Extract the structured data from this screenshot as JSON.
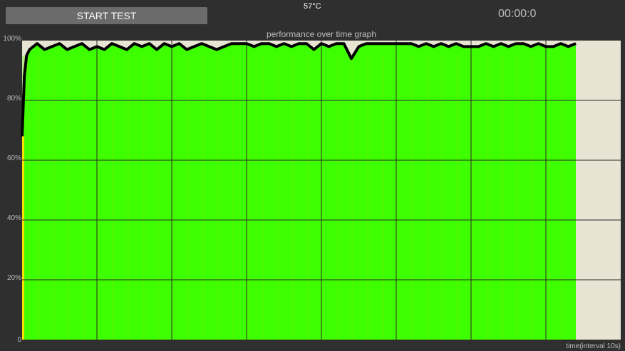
{
  "header": {
    "start_label": "START TEST",
    "temperature": "57°C",
    "timer": "00:00:0"
  },
  "colors": {
    "fill": "#3dff00",
    "background": "#e8e4d4",
    "line": "#000000",
    "start": "#ffe000"
  },
  "chart_data": {
    "type": "area",
    "title": "performance over time graph",
    "xlabel": "time(interval 10s)",
    "ylabel": "",
    "xlim": [
      0,
      80
    ],
    "ylim": [
      0,
      100
    ],
    "yticks": [
      {
        "v": 0,
        "label": "0"
      },
      {
        "v": 20,
        "label": "20%"
      },
      {
        "v": 40,
        "label": "40%"
      },
      {
        "v": 60,
        "label": "60%"
      },
      {
        "v": 80,
        "label": "80%"
      },
      {
        "v": 100,
        "label": "100%"
      }
    ],
    "xgrid": [
      10,
      20,
      30,
      40,
      50,
      60,
      70
    ],
    "x": [
      0,
      0.3,
      0.6,
      1,
      2,
      3,
      4,
      5,
      6,
      7,
      8,
      9,
      10,
      11,
      12,
      13,
      14,
      15,
      16,
      17,
      18,
      19,
      20,
      21,
      22,
      23,
      24,
      25,
      26,
      27,
      28,
      29,
      30,
      31,
      32,
      33,
      34,
      35,
      36,
      37,
      38,
      39,
      40,
      41,
      42,
      43,
      44,
      45,
      46,
      47,
      48,
      49,
      50,
      51,
      52,
      53,
      54,
      55,
      56,
      57,
      58,
      59,
      60,
      61,
      62,
      63,
      64,
      65,
      66,
      67,
      68,
      69,
      70,
      71,
      72,
      73,
      74
    ],
    "values": [
      68,
      88,
      95,
      97,
      99,
      97,
      98,
      99,
      97,
      98,
      99,
      97,
      98,
      97,
      99,
      98,
      97,
      99,
      98,
      99,
      97,
      99,
      98,
      99,
      97,
      98,
      99,
      98,
      97,
      98,
      99,
      99,
      99,
      98,
      99,
      99,
      98,
      99,
      98,
      99,
      99,
      97,
      99,
      98,
      99,
      99,
      94,
      98,
      99,
      99,
      99,
      99,
      99,
      99,
      99,
      98,
      99,
      98,
      99,
      98,
      99,
      98,
      98,
      98,
      99,
      98,
      99,
      98,
      99,
      99,
      98,
      99,
      98,
      98,
      99,
      98,
      99
    ]
  }
}
